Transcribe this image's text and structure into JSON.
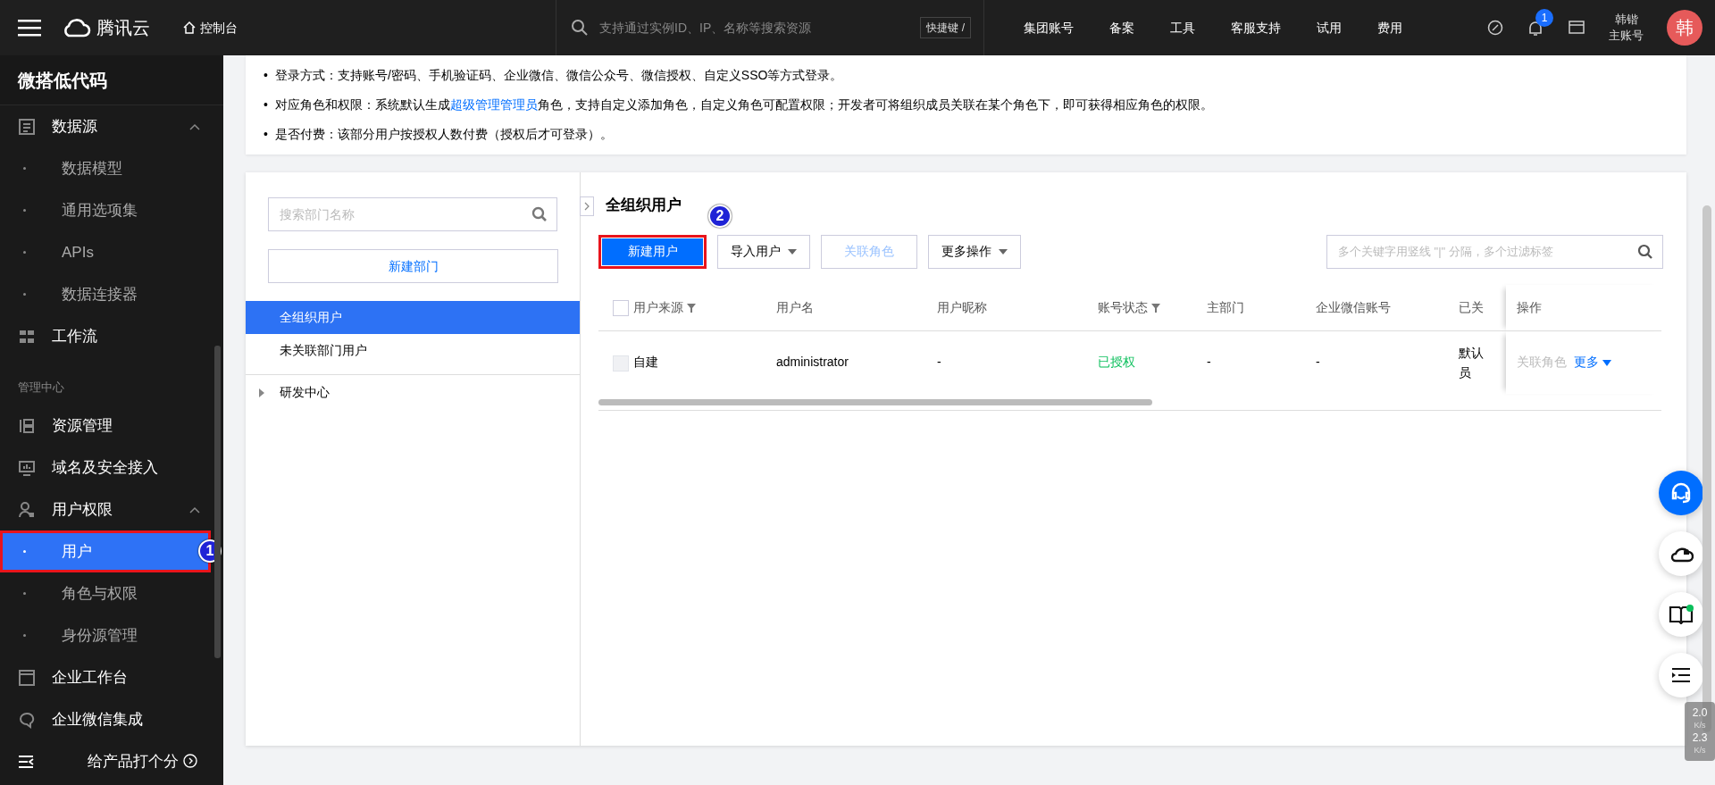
{
  "topbar": {
    "logo_text": "腾讯云",
    "console": "控制台",
    "search_placeholder": "支持通过实例ID、IP、名称等搜索资源",
    "shortcut": "快捷键 /",
    "nav": [
      "集团账号",
      "备案",
      "工具",
      "客服支持",
      "试用",
      "费用"
    ],
    "notification_count": "1",
    "user_name": "韩锴",
    "user_role": "主账号",
    "avatar_text": "韩"
  },
  "sidebar": {
    "title": "微搭低代码",
    "items": [
      {
        "kind": "group",
        "label": "数据源",
        "expanded": true,
        "selected": false
      },
      {
        "kind": "sub",
        "label": "数据模型",
        "selected": false
      },
      {
        "kind": "sub",
        "label": "通用选项集",
        "selected": false
      },
      {
        "kind": "sub",
        "label": "APIs",
        "selected": false
      },
      {
        "kind": "sub",
        "label": "数据连接器",
        "selected": false
      },
      {
        "kind": "group",
        "label": "工作流",
        "selected": false
      },
      {
        "kind": "section",
        "label": "管理中心"
      },
      {
        "kind": "group",
        "label": "资源管理",
        "selected": false
      },
      {
        "kind": "group",
        "label": "域名及安全接入",
        "selected": false
      },
      {
        "kind": "group",
        "label": "用户权限",
        "expanded": true,
        "selected": false
      },
      {
        "kind": "sub",
        "label": "用户",
        "selected": true,
        "callout": "1"
      },
      {
        "kind": "sub",
        "label": "角色与权限",
        "selected": false
      },
      {
        "kind": "sub",
        "label": "身份源管理",
        "selected": false
      },
      {
        "kind": "group",
        "label": "企业工作台",
        "selected": false
      },
      {
        "kind": "group",
        "label": "企业微信集成",
        "selected": false
      }
    ],
    "footer": "给产品打个分"
  },
  "info": {
    "bullet": "•",
    "bullets": [
      "登录方式：支持账号/密码、手机验证码、企业微信、微信公众号、微信授权、自定义SSO等方式登录。",
      {
        "before": "对应角色和权限：系统默认生成",
        "link": "超级管理管理员",
        "after": "角色，支持自定义添加角色，自定义角色可配置权限；开发者可将组织成员关联在某个角色下，即可获得相应角色的权限。"
      },
      "是否付费：该部分用户按授权人数付费（授权后才可登录）。"
    ]
  },
  "departments": {
    "search_placeholder": "搜索部门名称",
    "new_button": "新建部门",
    "list": [
      {
        "label": "全组织用户",
        "selected": true
      },
      {
        "label": "未关联部门用户",
        "selected": false
      }
    ],
    "tree": [
      {
        "label": "研发中心",
        "expanded": false
      }
    ]
  },
  "users": {
    "title": "全组织用户",
    "buttons": [
      {
        "label": "新建用户",
        "kind": "primary",
        "callout": "2"
      },
      {
        "label": "导入用户",
        "kind": "dropdown"
      },
      {
        "label": "关联角色",
        "kind": "disabled"
      },
      {
        "label": "更多操作",
        "kind": "dropdown"
      }
    ],
    "search_placeholder": "多个关键字用竖线 \"|\" 分隔，多个过滤标签",
    "all_checked": false,
    "columns": [
      {
        "label": "用户来源",
        "filter": true
      },
      {
        "label": "用户名",
        "filter": false
      },
      {
        "label": "用户昵称",
        "filter": false
      },
      {
        "label": "账号状态",
        "filter": true
      },
      {
        "label": "主部门",
        "filter": false
      },
      {
        "label": "企业微信账号",
        "filter": false
      },
      {
        "label": "已关",
        "filter": false
      }
    ],
    "actions_column": "操作",
    "rows": [
      {
        "checked": false,
        "cells": [
          "自建",
          "administrator",
          "-",
          "已授权",
          "-",
          "-",
          "默认员"
        ],
        "color": "#0abf5b",
        "actions": [
          {
            "label": "关联角色",
            "disabled": true,
            "caret": false
          },
          {
            "label": "更多",
            "disabled": false,
            "caret": true
          }
        ]
      }
    ]
  },
  "speed_widget": {
    "up": "2.0",
    "down": "2.3",
    "unit_up": "K/s",
    "unit_down": "K/s"
  }
}
